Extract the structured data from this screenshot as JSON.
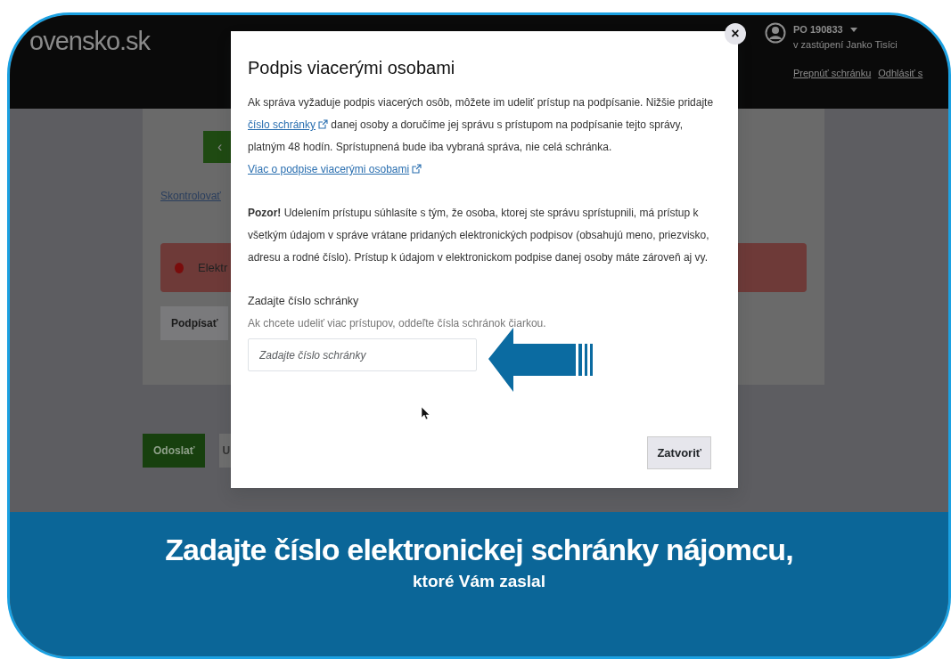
{
  "header": {
    "logo": "ovensko.sk",
    "account": {
      "id": "PO 190833",
      "represented": "v zastúpení Janko Tisíci",
      "links": [
        "Prepnúť schránku",
        "Odhlásiť s"
      ]
    }
  },
  "page": {
    "back_button": "‹",
    "check_link": "Skontrolovať",
    "alert": "Elektr",
    "sign_button": "Podpísať",
    "send_button": "Odoslať",
    "other_button": "U"
  },
  "modal": {
    "close_icon": "×",
    "title": "Podpis viacerými osobami",
    "intro": [
      {
        "kind": "text",
        "text": "Ak správa vyžaduje podpis viacerých osôb, môžete im udeliť prístup na podpísanie. Nižšie pridajte "
      },
      {
        "kind": "link",
        "text": "číslo schránky"
      },
      {
        "kind": "text",
        "text": " danej osoby a doručíme jej správu s prístupom na podpísanie tejto správy, platným 48 hodín. Sprístupnená bude iba vybraná správa, nie celá schránka. "
      },
      {
        "kind": "link",
        "text": "Viac o podpise viacerými osobami"
      }
    ],
    "warning": "**Pozor!** Udelením prístupu súhlasíte s tým, že osoba, ktorej ste správu sprístupnili, má prístup k všetkým údajom v správe vrátane pridaných elektronických podpisov (obsahujú meno, priezvisko, adresu a rodné číslo). Prístup k údajom v elektronickom podpise danej osoby máte zároveň aj vy.",
    "field": {
      "label": "Zadajte číslo schránky",
      "help": "Ak chcete udeliť viac prístupov, oddeľte čísla schránok čiarkou.",
      "placeholder": "Zadajte číslo schránky"
    },
    "close_button": "Zatvoriť"
  },
  "caption": {
    "title": "Zadajte číslo elektronickej schránky nájomcu,",
    "subtitle": "ktoré Vám zaslal"
  }
}
